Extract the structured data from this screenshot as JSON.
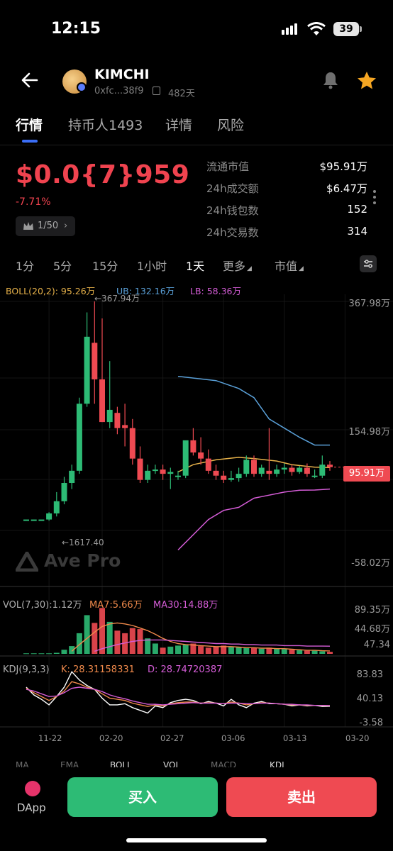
{
  "status_bar": {
    "time": "12:15",
    "battery": "39"
  },
  "header": {
    "token_name": "KIMCHI",
    "address": "0xfc...38f9",
    "age": "482天"
  },
  "tabs": [
    "行情",
    "持币人1493",
    "详情",
    "风险"
  ],
  "price": {
    "value": "$0.0{7}959",
    "change": "-7.71%",
    "rank": "1/50"
  },
  "stats": [
    {
      "label": "流通市值",
      "value": "$95.91万"
    },
    {
      "label": "24h成交额",
      "value": "$6.47万"
    },
    {
      "label": "24h钱包数",
      "value": "152"
    },
    {
      "label": "24h交易数",
      "value": "314"
    }
  ],
  "intervals": [
    "1分",
    "5分",
    "15分",
    "1小时",
    "1天",
    "更多",
    "市值"
  ],
  "boll_legend": {
    "boll": "BOLL(20,2): 95.26万",
    "ub": "UB: 132.16万",
    "lb": "LB: 58.36万"
  },
  "price_axis": [
    "367.98万",
    "154.98万",
    "-58.02万"
  ],
  "current_tag": "95.91万",
  "high_marker": "←367.94万",
  "low_marker": "←1617.40",
  "watermark": "Ave Pro",
  "vol_legend": {
    "vol": "VOL(7,30):1.12万",
    "ma7": "MA7:5.66万",
    "ma30": "MA30:14.88万"
  },
  "vol_axis": [
    "89.35万",
    "44.68万",
    "47.34"
  ],
  "kdj_legend": {
    "kdj": "KDJ(9,3,3)",
    "k": "K: 28.31158331",
    "d": "D: 28.74720387"
  },
  "kdj_axis": [
    "83.83",
    "40.13",
    "-3.58"
  ],
  "dates": [
    "11-22",
    "02-20",
    "02-27",
    "03-06",
    "03-13",
    "03-20"
  ],
  "indicator_tabs": [
    "MA",
    "EMA",
    "BOLL",
    "VOL",
    "MACD",
    "KDJ"
  ],
  "actions": {
    "buy": "买入",
    "sell": "卖出",
    "dapp": "DApp"
  },
  "colors": {
    "up": "#2dbb75",
    "down": "#ef4a52",
    "accent": "#3b6ef6",
    "boll_mid": "#e7b24a",
    "boll_ub": "#5aa0d8",
    "boll_lb": "#d45cd6"
  },
  "chart_data": {
    "type": "candlestick",
    "unit": "万 (market cap)",
    "price_range": [
      -58.02,
      367.98
    ],
    "candles": [
      {
        "o": 10,
        "h": 10,
        "l": 10,
        "c": 10
      },
      {
        "o": 10,
        "h": 10,
        "l": 10,
        "c": 10
      },
      {
        "o": 10,
        "h": 10,
        "l": 10,
        "c": 10
      },
      {
        "o": 10,
        "h": 22,
        "l": 8,
        "c": 20
      },
      {
        "o": 20,
        "h": 55,
        "l": 15,
        "c": 40
      },
      {
        "o": 40,
        "h": 80,
        "l": 35,
        "c": 70
      },
      {
        "o": 70,
        "h": 100,
        "l": 60,
        "c": 90
      },
      {
        "o": 90,
        "h": 210,
        "l": 85,
        "c": 200
      },
      {
        "o": 200,
        "h": 350,
        "l": 195,
        "c": 310
      },
      {
        "o": 300,
        "h": 367.94,
        "l": 200,
        "c": 240
      },
      {
        "o": 240,
        "h": 340,
        "l": 170,
        "c": 170
      },
      {
        "o": 170,
        "h": 270,
        "l": 160,
        "c": 190
      },
      {
        "o": 185,
        "h": 195,
        "l": 150,
        "c": 160
      },
      {
        "o": 165,
        "h": 200,
        "l": 130,
        "c": 160
      },
      {
        "o": 160,
        "h": 175,
        "l": 100,
        "c": 110
      },
      {
        "o": 110,
        "h": 130,
        "l": 70,
        "c": 75
      },
      {
        "o": 75,
        "h": 100,
        "l": 70,
        "c": 90
      },
      {
        "o": 90,
        "h": 100,
        "l": 85,
        "c": 92
      },
      {
        "o": 92,
        "h": 100,
        "l": 75,
        "c": 85
      },
      {
        "o": 85,
        "h": 95,
        "l": 60,
        "c": 88
      },
      {
        "o": 80,
        "h": 90,
        "l": 75,
        "c": 82
      },
      {
        "o": 82,
        "h": 130,
        "l": 78,
        "c": 140
      },
      {
        "o": 140,
        "h": 160,
        "l": 115,
        "c": 120
      },
      {
        "o": 120,
        "h": 145,
        "l": 100,
        "c": 110
      },
      {
        "o": 110,
        "h": 125,
        "l": 85,
        "c": 90
      },
      {
        "o": 90,
        "h": 100,
        "l": 75,
        "c": 82
      },
      {
        "o": 82,
        "h": 90,
        "l": 70,
        "c": 75
      },
      {
        "o": 75,
        "h": 90,
        "l": 72,
        "c": 78
      },
      {
        "o": 78,
        "h": 95,
        "l": 72,
        "c": 85
      },
      {
        "o": 85,
        "h": 115,
        "l": 80,
        "c": 108
      },
      {
        "o": 108,
        "h": 115,
        "l": 80,
        "c": 85
      },
      {
        "o": 85,
        "h": 100,
        "l": 80,
        "c": 95
      },
      {
        "o": 90,
        "h": 160,
        "l": 75,
        "c": 85
      },
      {
        "o": 85,
        "h": 100,
        "l": 80,
        "c": 92
      },
      {
        "o": 92,
        "h": 102,
        "l": 85,
        "c": 95
      },
      {
        "o": 95,
        "h": 100,
        "l": 82,
        "c": 88
      },
      {
        "o": 88,
        "h": 98,
        "l": 85,
        "c": 95
      },
      {
        "o": 95,
        "h": 102,
        "l": 80,
        "c": 85
      },
      {
        "o": 82,
        "h": 92,
        "l": 78,
        "c": 82
      },
      {
        "o": 82,
        "h": 115,
        "l": 78,
        "c": 100
      },
      {
        "o": 100,
        "h": 106,
        "l": 90,
        "c": 95.91
      }
    ],
    "boll_mid": [
      {
        "i": 20,
        "v": 88
      },
      {
        "i": 22,
        "v": 100
      },
      {
        "i": 25,
        "v": 108
      },
      {
        "i": 28,
        "v": 112
      },
      {
        "i": 30,
        "v": 110
      },
      {
        "i": 33,
        "v": 106
      },
      {
        "i": 35,
        "v": 100
      },
      {
        "i": 38,
        "v": 96
      },
      {
        "i": 40,
        "v": 95.26
      }
    ],
    "boll_ub": [
      {
        "i": 20,
        "v": 245
      },
      {
        "i": 25,
        "v": 238
      },
      {
        "i": 28,
        "v": 225
      },
      {
        "i": 30,
        "v": 210
      },
      {
        "i": 32,
        "v": 175
      },
      {
        "i": 34,
        "v": 160
      },
      {
        "i": 36,
        "v": 145
      },
      {
        "i": 38,
        "v": 132.16
      },
      {
        "i": 40,
        "v": 132.16
      }
    ],
    "boll_lb": [
      {
        "i": 20,
        "v": -40
      },
      {
        "i": 24,
        "v": 10
      },
      {
        "i": 26,
        "v": 25
      },
      {
        "i": 28,
        "v": 30
      },
      {
        "i": 30,
        "v": 45
      },
      {
        "i": 32,
        "v": 50
      },
      {
        "i": 34,
        "v": 55
      },
      {
        "i": 36,
        "v": 58
      },
      {
        "i": 38,
        "v": 58.36
      },
      {
        "i": 40,
        "v": 60
      }
    ],
    "volume_range": [
      0,
      89.35
    ],
    "volumes": [
      1,
      1,
      1,
      1,
      2,
      8,
      15,
      40,
      75,
      60,
      89,
      62,
      45,
      40,
      50,
      48,
      30,
      20,
      12,
      14,
      16,
      18,
      20,
      15,
      12,
      14,
      16,
      14,
      13,
      12,
      11,
      10,
      12,
      10,
      9,
      8,
      7,
      6,
      6,
      5,
      4
    ],
    "vol_ma7": [
      null,
      null,
      null,
      null,
      null,
      null,
      5,
      18,
      30,
      42,
      53,
      58,
      60,
      58,
      55,
      50,
      45,
      38,
      30,
      24,
      20,
      18,
      17,
      16,
      15,
      14,
      14,
      14,
      13,
      12,
      12,
      11,
      11,
      10,
      10,
      9,
      8,
      7,
      7,
      6,
      5.66
    ],
    "vol_ma30": [
      null,
      null,
      null,
      null,
      null,
      null,
      null,
      null,
      null,
      5,
      10,
      14,
      18,
      21,
      24,
      26,
      27,
      27,
      27,
      26,
      25,
      24,
      23,
      22,
      21,
      20,
      20,
      19,
      19,
      18,
      18,
      17,
      17,
      17,
      16,
      16,
      16,
      15,
      15,
      15,
      14.88
    ],
    "kdj_range": [
      -3.58,
      83.83
    ],
    "kdj_k": [
      60,
      52,
      45,
      38,
      45,
      55,
      72,
      68,
      62,
      58,
      50,
      42,
      40,
      38,
      33,
      30,
      27,
      30,
      28,
      32,
      34,
      35,
      35,
      33,
      34,
      33,
      32,
      35,
      33,
      30,
      32,
      34,
      33,
      32,
      31,
      30,
      30,
      29,
      29,
      28.5,
      28.31
    ],
    "kdj_d": [
      58,
      55,
      50,
      45,
      46,
      52,
      60,
      62,
      60,
      58,
      54,
      48,
      44,
      41,
      37,
      34,
      31,
      31,
      30,
      31,
      32,
      33,
      34,
      33,
      33,
      33,
      32,
      33,
      33,
      32,
      32,
      33,
      33,
      32,
      31,
      31,
      30,
      30,
      29,
      29,
      28.75
    ],
    "kdj_j": [
      62,
      48,
      40,
      30,
      45,
      62,
      90,
      75,
      65,
      58,
      42,
      30,
      30,
      32,
      25,
      20,
      15,
      28,
      25,
      34,
      38,
      40,
      38,
      32,
      36,
      33,
      28,
      40,
      30,
      25,
      33,
      36,
      32,
      32,
      31,
      28,
      30,
      28,
      29,
      27,
      27.4
    ],
    "x_labels": [
      "11-22",
      "02-20",
      "02-27",
      "03-06",
      "03-13",
      "03-20"
    ]
  }
}
